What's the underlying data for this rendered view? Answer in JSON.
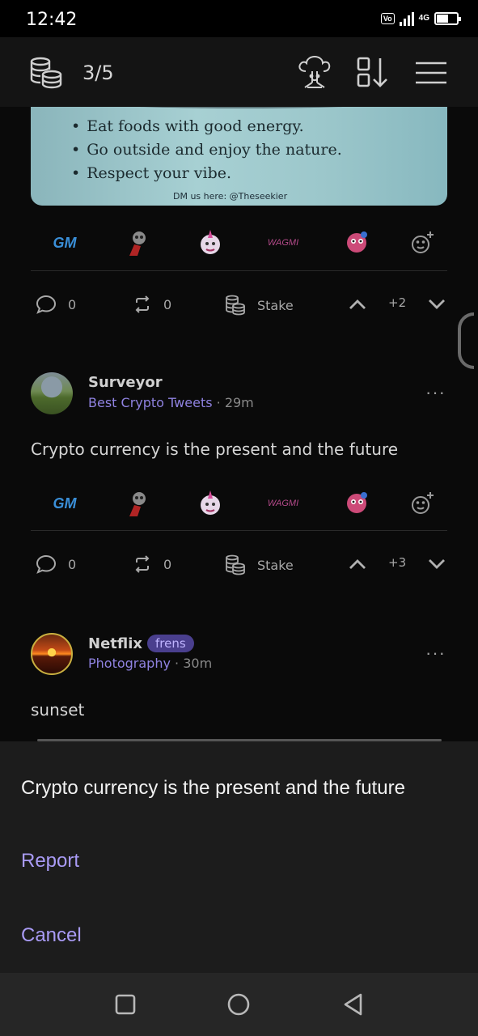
{
  "status_bar": {
    "time": "12:42",
    "volte_label": "Vo LTE",
    "network": "4G"
  },
  "header": {
    "stake_count": "3/5",
    "icons": [
      "coins-icon",
      "tree-avatar-icon",
      "sort-icon",
      "menu-icon"
    ]
  },
  "post_top": {
    "image_lines": [
      "Eat foods with good energy.",
      "Go outside and enjoy the nature.",
      "Respect your vibe."
    ],
    "image_credit": "DM us here: @Theseekier",
    "reactions": [
      "GM",
      "skull-sticker",
      "unicorn-sticker",
      "WAGMI",
      "ghost-sticker",
      "add-reaction"
    ],
    "comments": "0",
    "reposts": "0",
    "stake_label": "Stake",
    "votes": "+2"
  },
  "post_surveyor": {
    "author": "Surveyor",
    "community": "Best Crypto Tweets",
    "time": "29m",
    "text": "Crypto currency is the present and the future",
    "reactions": [
      "GM",
      "WAGMI"
    ],
    "comments": "0",
    "reposts": "0",
    "stake_label": "Stake",
    "votes": "+3"
  },
  "post_netflix": {
    "author": "Netflix",
    "badge": "frens",
    "community": "Photography",
    "time": "30m",
    "text": "sunset"
  },
  "sheet": {
    "title": "Crypto currency is the present and the future",
    "report_label": "Report",
    "cancel_label": "Cancel"
  },
  "colors": {
    "accent": "#a99bf5",
    "community": "#8f82e0",
    "sheet_bg": "#1c1c1c"
  }
}
